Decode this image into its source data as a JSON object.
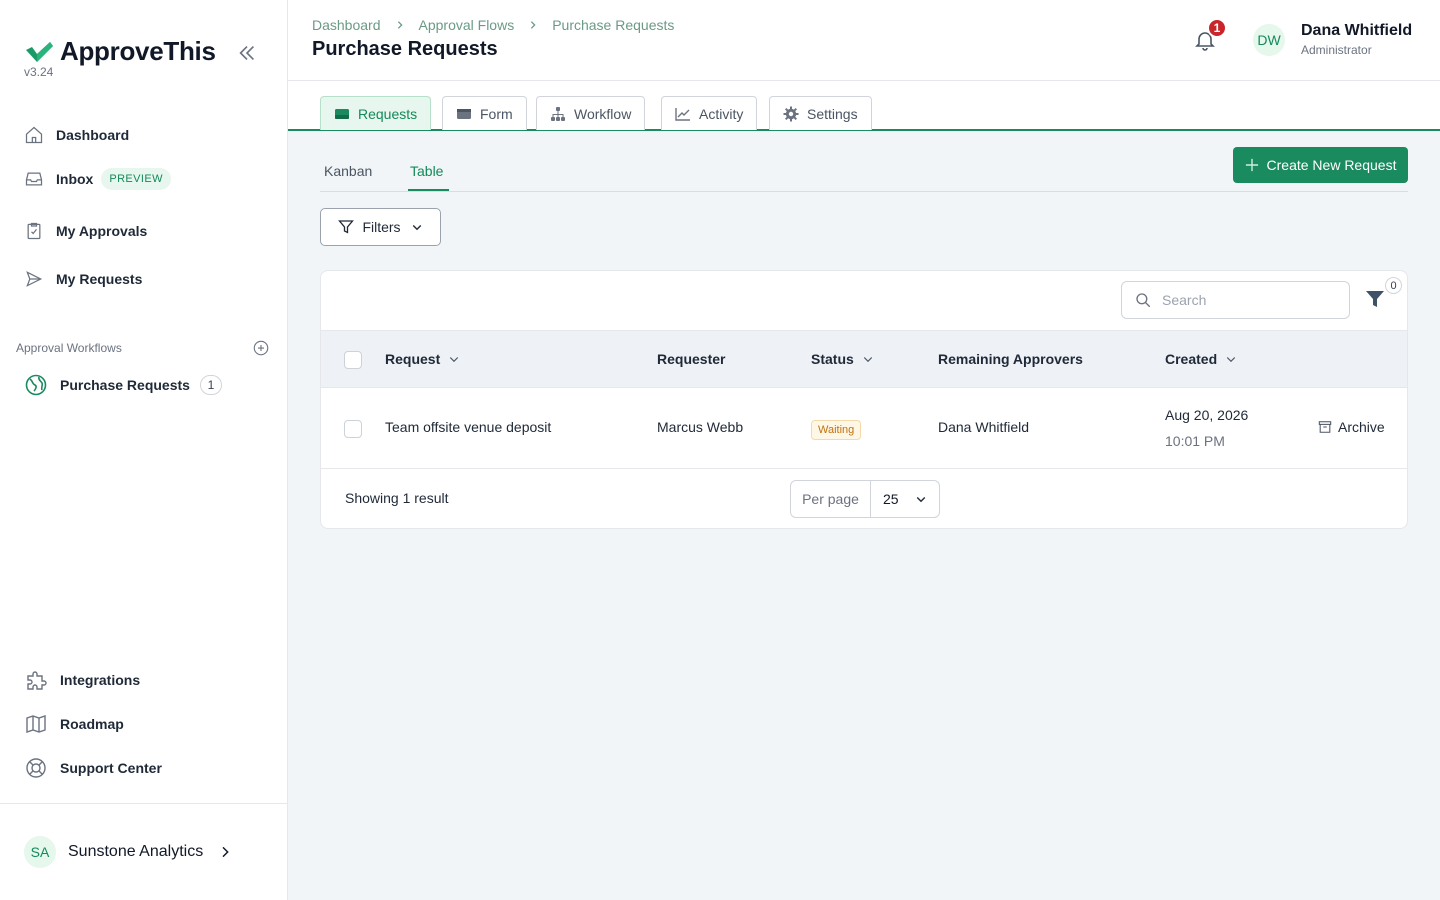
{
  "app": {
    "name": "ApproveThis",
    "version": "v3.24",
    "brand_color": "#1a8a5f"
  },
  "sidebar": {
    "nav": [
      {
        "label": "Dashboard",
        "icon": "home-icon"
      },
      {
        "label": "Inbox",
        "icon": "inbox-icon",
        "badge": "PREVIEW"
      },
      {
        "label": "My Approvals",
        "icon": "clipboard-check-icon"
      },
      {
        "label": "My Requests",
        "icon": "send-icon"
      }
    ],
    "workflows_label": "Approval Workflows",
    "workflows": [
      {
        "label": "Purchase Requests",
        "count": "1",
        "icon": "globe-icon"
      }
    ],
    "bottom": [
      {
        "label": "Integrations",
        "icon": "puzzle-icon"
      },
      {
        "label": "Roadmap",
        "icon": "map-icon"
      },
      {
        "label": "Support Center",
        "icon": "lifebuoy-icon"
      }
    ],
    "org": {
      "initials": "SA",
      "name": "Sunstone Analytics"
    }
  },
  "header": {
    "breadcrumb": [
      "Dashboard",
      "Approval Flows",
      "Purchase Requests"
    ],
    "title": "Purchase Requests",
    "notifications": "1",
    "user": {
      "initials": "DW",
      "name": "Dana Whitfield",
      "role": "Administrator"
    }
  },
  "tabs": [
    {
      "label": "Requests",
      "icon": "tray-icon",
      "active": true
    },
    {
      "label": "Form",
      "icon": "form-icon"
    },
    {
      "label": "Workflow",
      "icon": "sitemap-icon"
    },
    {
      "label": "Activity",
      "icon": "chart-line-icon"
    },
    {
      "label": "Settings",
      "icon": "gear-icon"
    }
  ],
  "view": {
    "subtabs": [
      "Kanban",
      "Table"
    ],
    "active_subtab": "Table",
    "create_button": "Create New Request",
    "filters_button": "Filters"
  },
  "table": {
    "search_placeholder": "Search",
    "filter_count": "0",
    "columns": [
      "Request",
      "Requester",
      "Status",
      "Remaining Approvers",
      "Created"
    ],
    "rows": [
      {
        "request": "Team offsite venue deposit",
        "requester": "Marcus Webb",
        "status": "Waiting",
        "remaining_approvers": "Dana Whitfield",
        "created_date": "Aug 20, 2026",
        "created_time": "10:01 PM",
        "action": "Archive"
      }
    ],
    "showing": "Showing 1 result",
    "per_page_label": "Per page",
    "per_page_value": "25"
  }
}
